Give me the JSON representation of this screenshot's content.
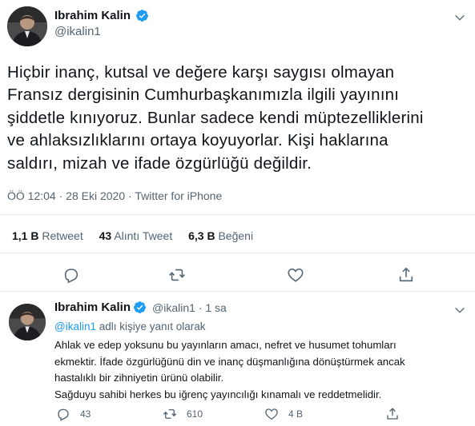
{
  "colors": {
    "accent": "#1d9bf0",
    "text": "#0f1419",
    "muted": "#536471",
    "divider": "#e6ecf0"
  },
  "main_tweet": {
    "author_name": "Ibrahim Kalin",
    "handle": "@ikalin1",
    "text_lines": [
      "Hiçbir inanç, kutsal ve değere karşı saygısı olmayan",
      "Fransız dergisinin Cumhurbaşkanımızla ilgili yayınını",
      "şiddetle kınıyoruz. Bunlar sadece kendi müptezelliklerini",
      "ve ahlaksızlıklarını ortaya koyuyorlar. Kişi haklarına",
      "saldırı, mizah ve ifade özgürlüğü değildir."
    ],
    "time": "ÖÖ 12:04",
    "date": "28 Eki 2020",
    "source": "Twitter for iPhone",
    "stats": {
      "retweet_count": "1,1 B",
      "retweet_label": "Retweet",
      "quote_count": "43",
      "quote_label": "Alıntı Tweet",
      "like_count": "6,3 B",
      "like_label": "Beğeni"
    }
  },
  "reply_tweet": {
    "author_name": "Ibrahim Kalin",
    "handle": "@ikalin1",
    "age": "1 sa",
    "replying_mention": "@ikalin1",
    "replying_text": "adlı kişiye yanıt olarak",
    "text_lines": [
      "Ahlak ve edep yoksunu bu yayınların amacı, nefret ve husumet tohumları",
      "ekmektir. İfade özgürlüğünü din ve inanç düşmanlığına dönüştürmek ancak",
      "hastalıklı bir zihniyetin ürünü olabilir.",
      "Sağduyu sahibi herkes bu iğrenç yayıncılığı kınamalı ve reddetmelidir."
    ],
    "reply_count": "43",
    "retweet_count": "610",
    "like_count": "4 B"
  },
  "icons": [
    "verified-icon",
    "chevron-down-icon",
    "reply-icon",
    "retweet-icon",
    "like-icon",
    "share-icon"
  ]
}
